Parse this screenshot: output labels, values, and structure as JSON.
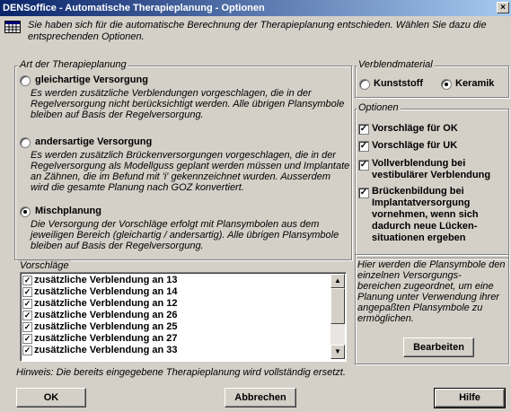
{
  "window": {
    "title": "DENSoffice - Automatische Therapieplanung - Optionen",
    "close_glyph": "×"
  },
  "intro": {
    "icon": "calendar-grid-icon",
    "line1": "Sie haben sich für die automatische Berechnung der Therapieplanung entschieden. Wählen Sie dazu die",
    "line2": "entsprechenden Optionen."
  },
  "art": {
    "legend": "Art der Therapieplanung",
    "options": [
      {
        "label": "gleichartige Versorgung",
        "selected": false,
        "desc": [
          "Es werden zusätzliche Verblendungen vorgeschlagen, die in der",
          "Regelversorgung nicht berücksichtigt werden. Alle übrigen Plansymbole",
          "bleiben auf Basis der Regelversorgung."
        ]
      },
      {
        "label": "andersartige Versorgung",
        "selected": false,
        "desc": [
          "Es werden zusätzlich Brückenversorgungen vorgeschlagen, die in der",
          "Regelversorgung als Modellguss geplant werden müssen und Implantate",
          "an Zähnen, die im Befund mit 'i' gekennzeichnet wurden. Ausserdem",
          "wird die gesamte Planung nach GOZ konvertiert."
        ]
      },
      {
        "label": "Mischplanung",
        "selected": true,
        "desc": [
          "Die Versorgung der Vorschläge erfolgt mit Plansymbolen aus dem",
          "jeweiligen Bereich (gleichartig / andersartig). Alle übrigen Plansymbole",
          "bleiben auf Basis der Regelversorgung."
        ]
      }
    ]
  },
  "vorschlaege": {
    "legend": "Vorschläge",
    "items": [
      "zusätzliche Verblendung an 13",
      "zusätzliche Verblendung an 14",
      "zusätzliche Verblendung an 12",
      "zusätzliche Verblendung an 26",
      "zusätzliche Verblendung an 25",
      "zusätzliche Verblendung an 27",
      "zusätzliche Verblendung an 33"
    ],
    "scroll_up_glyph": "▲",
    "scroll_down_glyph": "▼",
    "check_glyph": "✓"
  },
  "verblend": {
    "legend": "Verblendmaterial",
    "kunststoff": "Kunststoff",
    "keramik": "Keramik",
    "selected": "keramik"
  },
  "optionen": {
    "legend": "Optionen",
    "check_glyph": "✓",
    "items": [
      {
        "lines": [
          "Vorschläge für OK"
        ],
        "checked": true
      },
      {
        "lines": [
          "Vorschläge für UK"
        ],
        "checked": true
      },
      {
        "lines": [
          "Vollverblendung bei",
          "vestibulärer Verblendung"
        ],
        "checked": true
      },
      {
        "lines": [
          "Brückenbildung bei",
          "Implantatversorgung",
          "vornehmen, wenn sich",
          "dadurch neue Lücken-",
          "situationen ergeben"
        ],
        "checked": true
      }
    ]
  },
  "plansymbole": {
    "text": [
      "Hier werden die Plansymbole den",
      "einzelnen Versorgungs-",
      "bereichen zugeordnet, um eine",
      "Planung unter Verwendung ihrer",
      "angepaßten Plansymbole zu",
      "ermöglichen."
    ],
    "button": "Bearbeiten"
  },
  "hinweis": "Hinweis: Die bereits eingegebene Therapieplanung wird vollständig ersetzt.",
  "buttons": {
    "ok": "OK",
    "cancel": "Abbrechen",
    "help": "Hilfe"
  }
}
